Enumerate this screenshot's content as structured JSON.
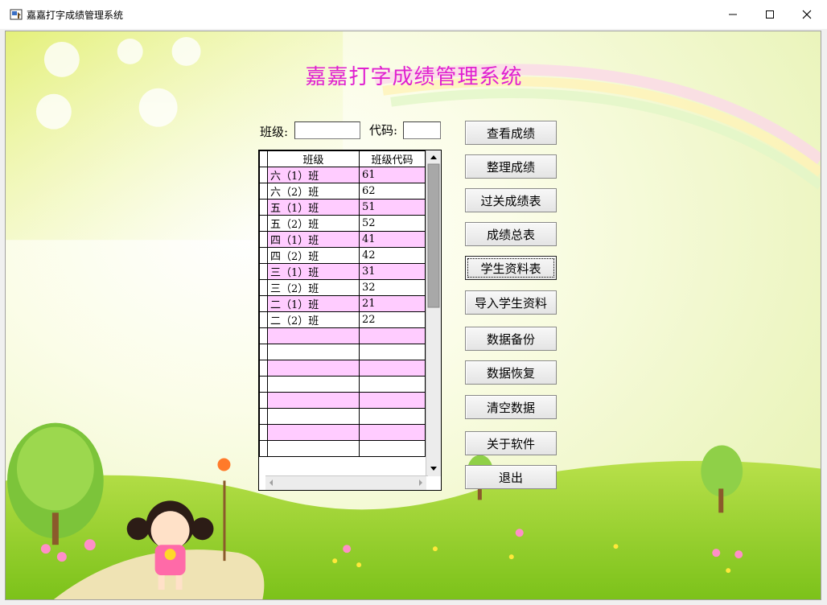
{
  "window": {
    "title": "嘉嘉打字成绩管理系统"
  },
  "header": {
    "title": "嘉嘉打字成绩管理系统"
  },
  "form": {
    "class_label": "班级:",
    "class_value": "",
    "code_label": "代码:",
    "code_value": ""
  },
  "grid": {
    "columns": [
      "班级",
      "班级代码"
    ],
    "rows": [
      {
        "name": "六（1）班",
        "code": "61"
      },
      {
        "name": "六（2）班",
        "code": "62"
      },
      {
        "name": "五（1）班",
        "code": "51"
      },
      {
        "name": "五（2）班",
        "code": "52"
      },
      {
        "name": "四（1）班",
        "code": "41"
      },
      {
        "name": "四（2）班",
        "code": "42"
      },
      {
        "name": "三（1）班",
        "code": "31"
      },
      {
        "name": "三（2）班",
        "code": "32"
      },
      {
        "name": "二（1）班",
        "code": "21"
      },
      {
        "name": "二（2）班",
        "code": "22"
      }
    ],
    "empty_rows": 8
  },
  "buttons": [
    {
      "label": "查看成绩"
    },
    {
      "label": "整理成绩"
    },
    {
      "label": "过关成绩表"
    },
    {
      "label": "成绩总表"
    },
    {
      "label": "学生资料表"
    },
    {
      "label": "导入学生资料"
    },
    {
      "label": "数据备份"
    },
    {
      "label": "数据恢复"
    },
    {
      "label": "清空数据"
    },
    {
      "label": "关于软件"
    },
    {
      "label": "退出"
    }
  ],
  "colors": {
    "title": "#e020d0",
    "row_highlight": "#ffccff"
  }
}
